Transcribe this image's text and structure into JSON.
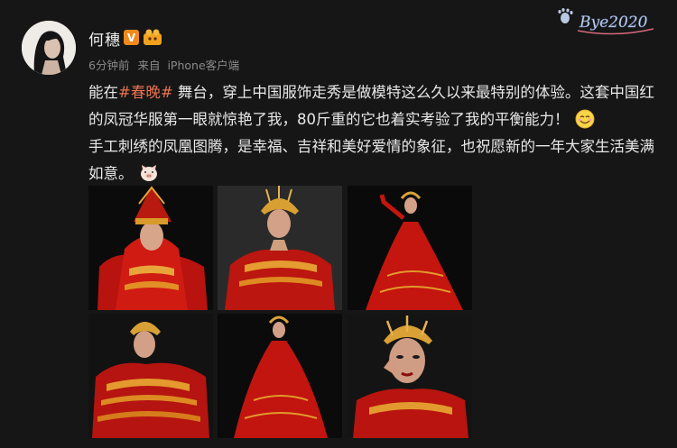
{
  "user": {
    "name": "何穗",
    "verified_badge": "V",
    "icon": "vip-icon"
  },
  "meta": {
    "time": "6分钟前",
    "source_prefix": "来自",
    "source": "iPhone客户端"
  },
  "sticker": {
    "text": "Bye2020"
  },
  "post": {
    "part1": "能在",
    "hashtag": "#春晚#",
    "part2": " 舞台，穿上中国服饰走秀是做模特这么久以来最特别的体验。这套中国红的凤冠华服第一眼就惊艳了我，80斤重的它也着实考验了我的平衡能力！",
    "part3": "手工刺绣的凤凰图腾，是幸福、吉祥和美好爱情的象征，也祝愿新的一年大家生活美满如意。",
    "emoji1": "smile-emoji",
    "emoji2": "piggy-emoji"
  },
  "photos": [
    "photo-1",
    "photo-2",
    "photo-3",
    "photo-4",
    "photo-5",
    "photo-6"
  ],
  "colors": {
    "background": "#161616",
    "hashtag": "#eb7350",
    "badge": "#f08a1c",
    "dress_red": "#c8140f"
  }
}
